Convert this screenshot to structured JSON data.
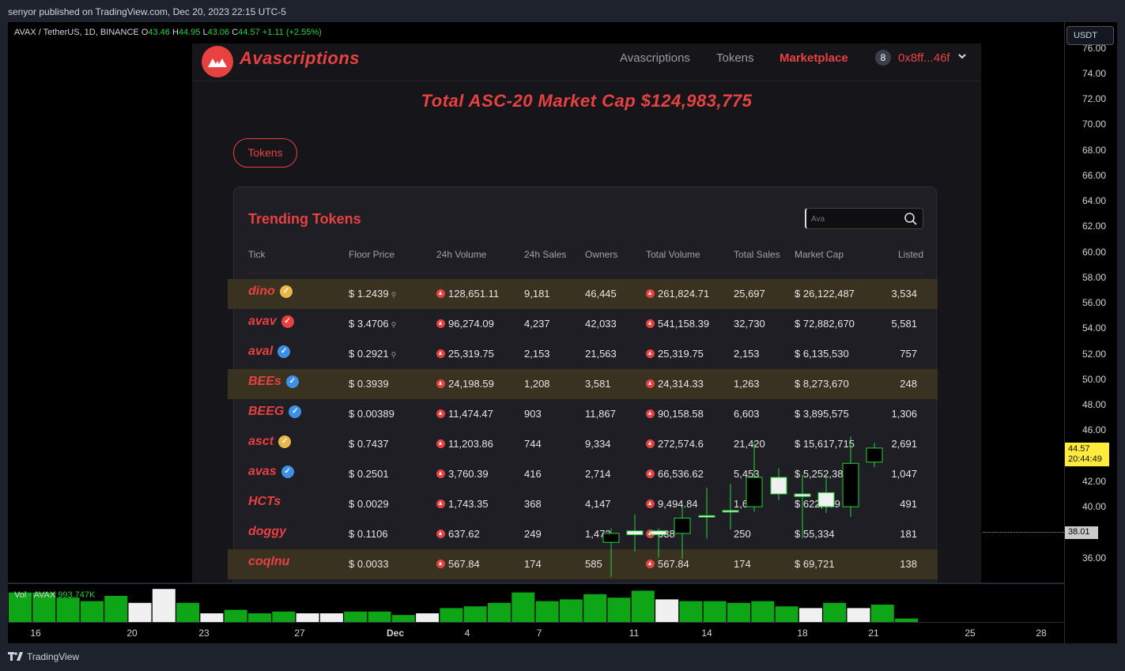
{
  "header": {
    "published_by": "senyor published on TradingView.com, Dec 20, 2023 22:15 UTC-5"
  },
  "legend": {
    "symbol": "AVAX / TetherUS, 1D, BINANCE",
    "o_label": "O",
    "o_value": "43.46",
    "h_label": "H",
    "h_value": "44.95",
    "l_label": "L",
    "l_value": "43.06",
    "c_label": "C",
    "c_value": "44.57",
    "change": "+1.11 (+2.55%)"
  },
  "price_scale": {
    "currency": "USDT",
    "ticks": [
      "76.00",
      "74.00",
      "72.00",
      "70.00",
      "68.00",
      "66.00",
      "64.00",
      "62.00",
      "60.00",
      "58.00",
      "56.00",
      "54.00",
      "52.00",
      "50.00",
      "48.00",
      "46.00",
      "42.00",
      "40.00",
      "36.00"
    ],
    "last_price": "44.57",
    "countdown": "20:44:49",
    "crosshair_price": "38.01"
  },
  "volume": {
    "label": "Vol · AVAX",
    "value": "993.747K"
  },
  "time_axis": {
    "ticks": [
      "16",
      "20",
      "23",
      "27",
      "Dec",
      "4",
      "7",
      "11",
      "14",
      "18",
      "21",
      "25",
      "28"
    ]
  },
  "footer": {
    "brand": "TradingView"
  },
  "site": {
    "logo_text": "Avascriptions",
    "nav": [
      "Avascriptions",
      "Tokens",
      "Marketplace"
    ],
    "wallet_count": "8",
    "wallet_address": "0x8ff...46f",
    "market_cap_title": "Total ASC-20 Market Cap $124,983,775",
    "tokens_button": "Tokens",
    "panel_title": "Trending Tokens",
    "search_placeholder": "Ava",
    "columns": [
      "Tick",
      "Floor Price",
      "24h Volume",
      "24h Sales",
      "Owners",
      "Total Volume",
      "Total Sales",
      "Market Cap",
      "Listed"
    ],
    "rows": [
      {
        "tick": "dino",
        "badge": "gold",
        "floor": "$ 1.2439",
        "vol24": "128,651.11",
        "sales24": "9,181",
        "owners": "46,445",
        "totalvol": "261,824.71",
        "totalsales": "25,697",
        "mcap": "$ 26,122,487",
        "listed": "3,534",
        "hl": true,
        "floor_icon": true
      },
      {
        "tick": "avav",
        "badge": "red",
        "floor": "$ 3.4706",
        "vol24": "96,274.09",
        "sales24": "4,237",
        "owners": "42,033",
        "totalvol": "541,158.39",
        "totalsales": "32,730",
        "mcap": "$ 72,882,670",
        "listed": "5,581",
        "hl": false,
        "floor_icon": true
      },
      {
        "tick": "aval",
        "badge": "blue",
        "floor": "$ 0.2921",
        "vol24": "25,319.75",
        "sales24": "2,153",
        "owners": "21,563",
        "totalvol": "25,319.75",
        "totalsales": "2,153",
        "mcap": "$ 6,135,530",
        "listed": "757",
        "hl": false,
        "floor_icon": true
      },
      {
        "tick": "BEEs",
        "badge": "blue",
        "floor": "$ 0.3939",
        "vol24": "24,198.59",
        "sales24": "1,208",
        "owners": "3,581",
        "totalvol": "24,314.33",
        "totalsales": "1,263",
        "mcap": "$ 8,273,670",
        "listed": "248",
        "hl": true,
        "floor_icon": false
      },
      {
        "tick": "BEEG",
        "badge": "blue",
        "floor": "$ 0.00389",
        "vol24": "11,474.47",
        "sales24": "903",
        "owners": "11,867",
        "totalvol": "90,158.58",
        "totalsales": "6,603",
        "mcap": "$ 3,895,575",
        "listed": "1,306",
        "hl": false,
        "floor_icon": false
      },
      {
        "tick": "asct",
        "badge": "gold",
        "floor": "$ 0.7437",
        "vol24": "11,203.86",
        "sales24": "744",
        "owners": "9,334",
        "totalvol": "272,574.6",
        "totalsales": "21,420",
        "mcap": "$ 15,617,715",
        "listed": "2,691",
        "hl": false,
        "floor_icon": false
      },
      {
        "tick": "avas",
        "badge": "blue",
        "floor": "$ 0.2501",
        "vol24": "3,760.39",
        "sales24": "416",
        "owners": "2,714",
        "totalvol": "66,536.62",
        "totalsales": "5,453",
        "mcap": "$ 5,252,38",
        "listed": "1,047",
        "hl": false,
        "floor_icon": false
      },
      {
        "tick": "HCTs",
        "badge": "",
        "floor": "$ 0.0029",
        "vol24": "1,743.35",
        "sales24": "368",
        "owners": "4,147",
        "totalvol": "9,494.84",
        "totalsales": "1,6",
        "mcap": "$ 622,459",
        "listed": "491",
        "hl": false,
        "floor_icon": false
      },
      {
        "tick": "doggy",
        "badge": "",
        "floor": "$ 0.1106",
        "vol24": "637.62",
        "sales24": "249",
        "owners": "1,472",
        "totalvol": "638",
        "totalsales": "250",
        "mcap": "$ 55,334",
        "listed": "181",
        "hl": false,
        "floor_icon": false
      },
      {
        "tick": "coqInu",
        "badge": "",
        "floor": "$ 0.0033",
        "vol24": "567.84",
        "sales24": "174",
        "owners": "585",
        "totalvol": "567.84",
        "totalsales": "174",
        "mcap": "$ 69,721",
        "listed": "138",
        "hl": true,
        "floor_icon": false
      }
    ]
  },
  "colors": {
    "accent": "#e84142",
    "up": "#26d13a",
    "highlight_row": "#3a3220",
    "badge_gold": "#e8b84a",
    "badge_red": "#e84142",
    "badge_blue": "#3d8fe8"
  }
}
